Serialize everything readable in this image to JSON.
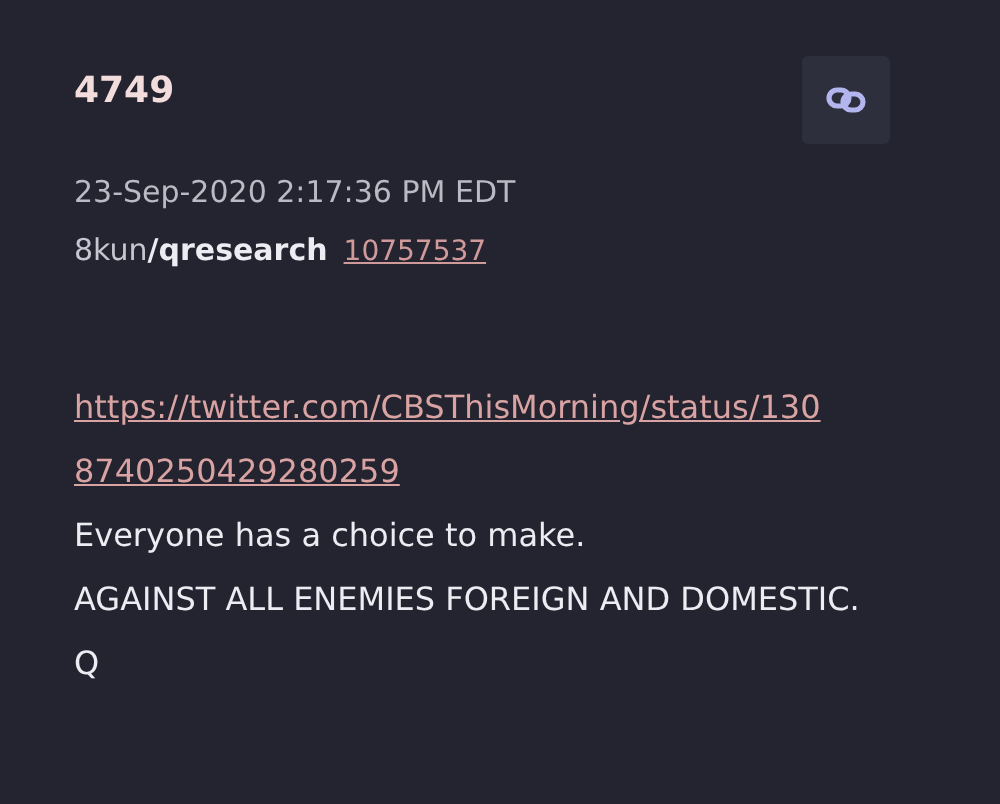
{
  "post": {
    "number": "4749",
    "timestamp": "23-Sep-2020 2:17:36 PM EDT",
    "site": "8kun",
    "board": "/qresearch",
    "post_id": "10757537"
  },
  "body": {
    "link_lines": [
      "https://twitter.com/CBSThisMorning/status/130",
      "8740250429280259"
    ],
    "lines": [
      "Everyone has a choice to make.",
      "AGAINST ALL ENEMIES FOREIGN AND DOMESTIC.",
      "Q"
    ]
  }
}
